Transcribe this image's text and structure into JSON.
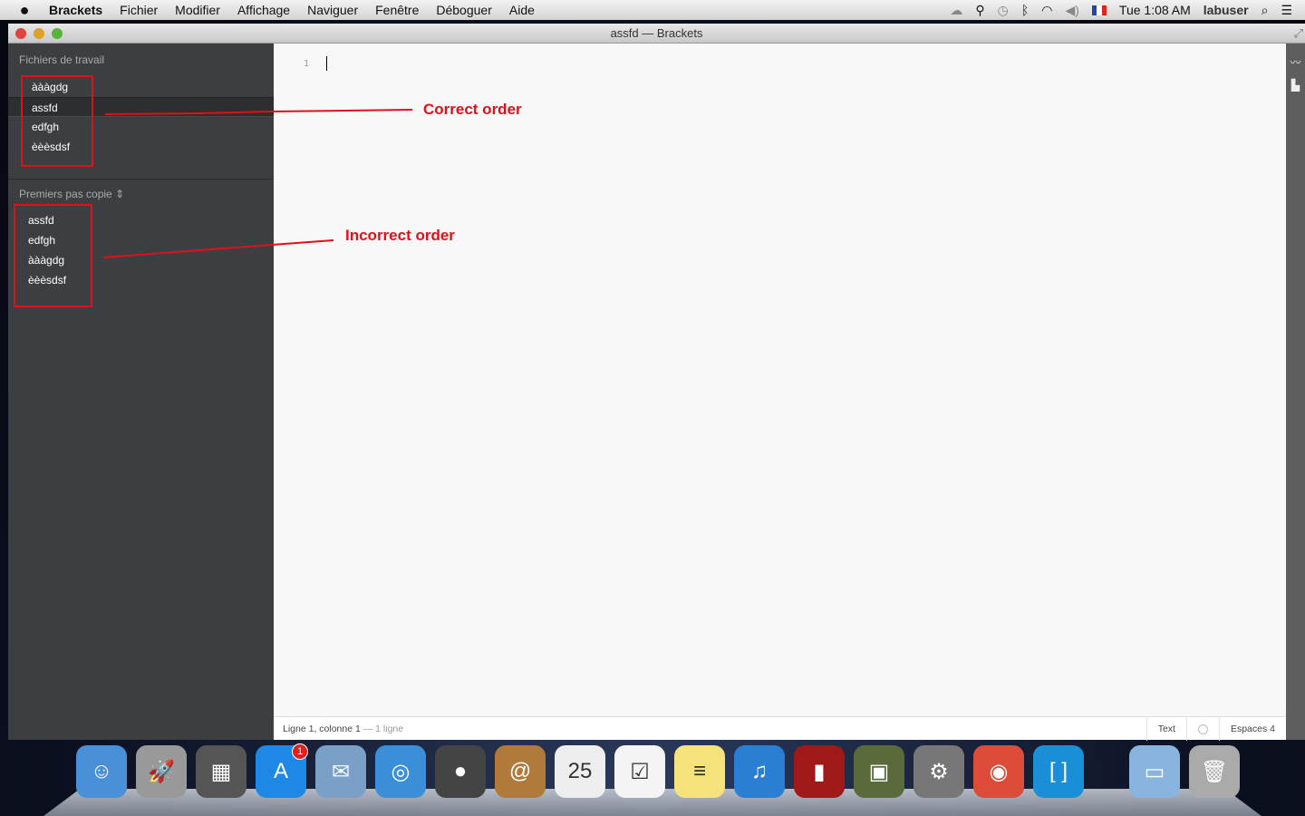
{
  "menubar": {
    "app": "Brackets",
    "items": [
      "Fichier",
      "Modifier",
      "Affichage",
      "Naviguer",
      "Fenêtre",
      "Déboguer",
      "Aide"
    ],
    "clock": "Tue 1:08 AM",
    "user": "labuser"
  },
  "window": {
    "title": "assfd — Brackets"
  },
  "sidebar": {
    "working_title": "Fichiers de travail",
    "working_files": [
      "àààgdg",
      "assfd",
      "edfgh",
      "èèèsdsf"
    ],
    "selected": "assfd",
    "project_title": "Premiers pas copie",
    "project_files": [
      "assfd",
      "edfgh",
      "àààgdg",
      "èèèsdsf"
    ]
  },
  "editor": {
    "line_number": "1"
  },
  "status": {
    "position": "Ligne 1, colonne 1",
    "lines": " — 1 ligne",
    "mode": "Text",
    "indent": "Espaces 4"
  },
  "annotations": {
    "correct": "Correct order",
    "incorrect": "Incorrect order",
    "color": "#e0101a"
  },
  "dock": {
    "items": [
      {
        "name": "Finder",
        "color": "#4a90d9",
        "glyph": "☺"
      },
      {
        "name": "Launchpad",
        "color": "#999",
        "glyph": "🚀"
      },
      {
        "name": "Photo Booth",
        "color": "#555",
        "glyph": "▦"
      },
      {
        "name": "App Store",
        "color": "#1e88e5",
        "glyph": "A",
        "badge": "1"
      },
      {
        "name": "Mail",
        "color": "#7aa0c8",
        "glyph": "✉"
      },
      {
        "name": "Safari",
        "color": "#3a8fd8",
        "glyph": "◎"
      },
      {
        "name": "FaceTime",
        "color": "#444",
        "glyph": "●"
      },
      {
        "name": "Contacts",
        "color": "#b07a3a",
        "glyph": "@"
      },
      {
        "name": "Calendar",
        "color": "#eee",
        "glyph": "25"
      },
      {
        "name": "Reminders",
        "color": "#f4f4f4",
        "glyph": "☑"
      },
      {
        "name": "Notes",
        "color": "#f5e27a",
        "glyph": "≡"
      },
      {
        "name": "iTunes",
        "color": "#2a7fd4",
        "glyph": "♫"
      },
      {
        "name": "Photo Booth 2",
        "color": "#a01818",
        "glyph": "▮"
      },
      {
        "name": "iPhoto",
        "color": "#5a6a3a",
        "glyph": "▣"
      },
      {
        "name": "System Preferences",
        "color": "#777",
        "glyph": "⚙"
      },
      {
        "name": "Chrome",
        "color": "#dd4b39",
        "glyph": "◉"
      },
      {
        "name": "Brackets",
        "color": "#1a8fd8",
        "glyph": "[ ]"
      },
      {
        "name": "Documents",
        "color": "#8ab4e0",
        "glyph": "▭"
      },
      {
        "name": "Trash",
        "color": "#aaa",
        "glyph": "🗑"
      }
    ]
  }
}
